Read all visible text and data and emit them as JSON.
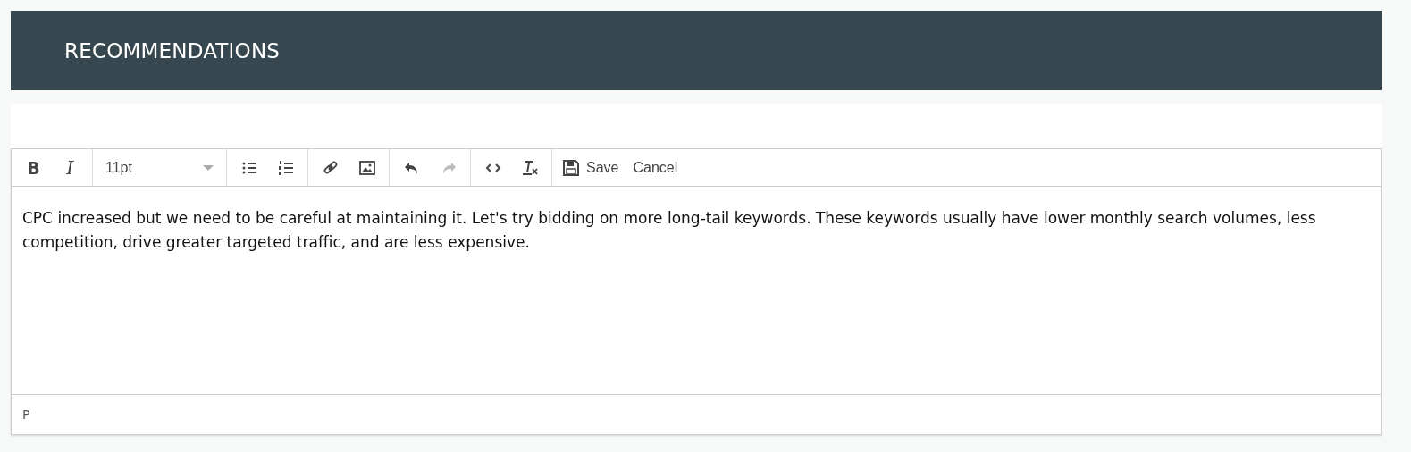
{
  "header": {
    "title": "RECOMMENDATIONS"
  },
  "editor": {
    "toolbar": [
      {
        "kind": "group",
        "buttons": [
          {
            "kind": "bold",
            "label": "B",
            "disabled": false
          },
          {
            "kind": "italic",
            "label": "I",
            "disabled": false
          }
        ]
      },
      {
        "kind": "select",
        "value": "11pt"
      },
      {
        "kind": "group",
        "buttons": [
          {
            "kind": "bullist",
            "disabled": false
          },
          {
            "kind": "numlist",
            "disabled": false
          }
        ]
      },
      {
        "kind": "group",
        "buttons": [
          {
            "kind": "link",
            "disabled": false
          },
          {
            "kind": "image",
            "disabled": false
          }
        ]
      },
      {
        "kind": "group",
        "buttons": [
          {
            "kind": "undo",
            "disabled": false
          },
          {
            "kind": "redo",
            "disabled": true
          }
        ]
      },
      {
        "kind": "group",
        "buttons": [
          {
            "kind": "code",
            "disabled": false
          },
          {
            "kind": "removeformat",
            "disabled": false
          }
        ]
      },
      {
        "kind": "group",
        "buttons": [
          {
            "kind": "save",
            "label": "Save",
            "disabled": false
          },
          {
            "kind": "cancel",
            "label": "Cancel",
            "disabled": false
          }
        ]
      }
    ],
    "content": "CPC increased but we need to be careful at maintaining it. Let's try bidding on more long-tail keywords. These keywords usually have lower monthly search volumes, less competition, drive greater targeted traffic, and are less expensive.",
    "status_path": "P"
  }
}
